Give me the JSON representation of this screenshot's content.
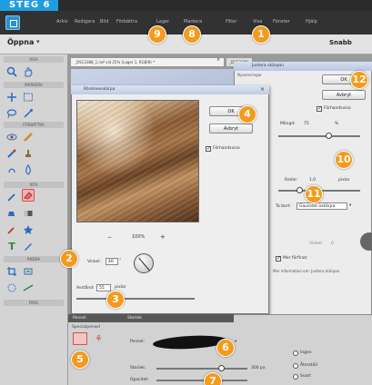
{
  "banner": {
    "text": "STEG 6"
  },
  "menubar": {
    "items": [
      "Arkiv",
      "Redigera",
      "Bild",
      "Förbättra",
      "Lager",
      "Markera",
      "Filter",
      "Visa",
      "Fönster",
      "Hjälp"
    ]
  },
  "toolbar": {
    "open_label": "Öppna",
    "open_chevron": "▾",
    "mode_label": "Snabb"
  },
  "tools": {
    "sections": [
      "VISA",
      "MARKERA",
      "FÖRBÄTTRA",
      "RITA",
      "ÄNDRA",
      "FÄRG"
    ]
  },
  "document": {
    "tab_title": "_DSC3388_1.nef vid 25% (Lager 1, RGB/8) *",
    "tab_close": "×",
    "tab2_title": "_DSC3388"
  },
  "right_dialog": {
    "title": "Justera skärpan",
    "section_label": "Nyanseringar",
    "ok": "OK",
    "cancel": "Avbryt",
    "preview_label": "Förhandsvisa",
    "amount_label": "Mängd:",
    "amount_value": "75",
    "amount_unit": "%",
    "radius_label": "Radie:",
    "radius_value": "1,0",
    "radius_unit": "pixlar",
    "remove_label": "Ta bort:",
    "remove_value": "Gaussisk oskärpa",
    "angle_label": "Vinkel:",
    "angle_value": "0",
    "finer_label": "Mer förfinat",
    "footer": "Mer information om: Justera skärpan"
  },
  "left_dialog": {
    "title": "Rörelseoskärpa",
    "close": "×",
    "ok": "OK",
    "cancel": "Avbryt",
    "preview_label": "Förhandsvisa",
    "zoom_minus": "−",
    "zoom_value": "100%",
    "zoom_plus": "+",
    "angle_label": "Vinkel:",
    "angle_value": "40",
    "angle_unit": "°",
    "distance_label": "Avstånd:",
    "distance_value": "55",
    "distance_unit": "pixlar"
  },
  "bottom_panel": {
    "tab1": "Pensel",
    "tab2": "Storlek",
    "brush_label": "Pensel:",
    "size_label": "Storlek:",
    "size_value": "300 px",
    "opacity_label": "Opacitet:",
    "opt1": "Ingen",
    "opt2": "Återställ",
    "opt3": "Svart",
    "section_label": "Specialpensel"
  },
  "callouts": [
    "1",
    "2",
    "3",
    "4",
    "5",
    "6",
    "7",
    "8",
    "9",
    "10",
    "11",
    "12"
  ],
  "colors": {
    "accent_blue": "#1f9de0",
    "callout_orange": "#f59a1b",
    "menubar": "#323232"
  }
}
